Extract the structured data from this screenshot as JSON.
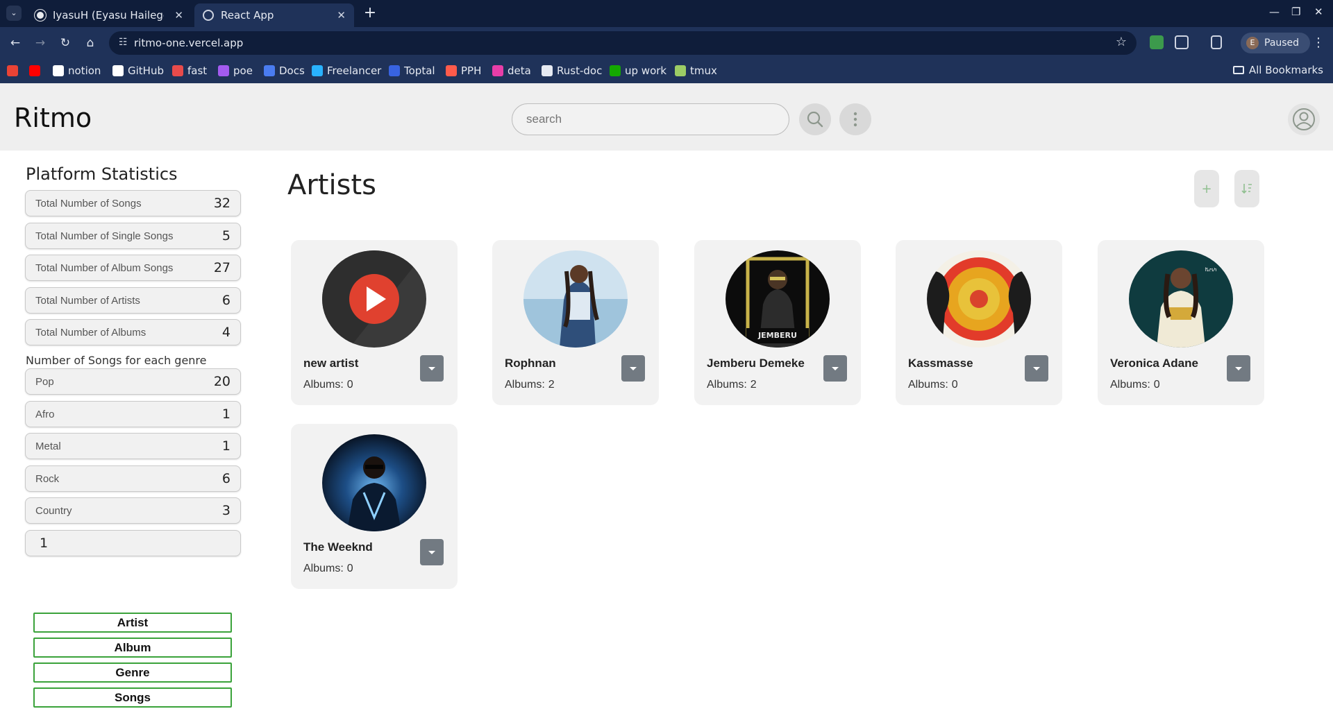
{
  "browser": {
    "tabs": [
      {
        "title": "IyasuH (Eyasu Hailegebr",
        "close": "✕"
      },
      {
        "title": "React App",
        "close": "✕"
      }
    ],
    "new_tab": "+",
    "url": "ritmo-one.vercel.app",
    "profile": {
      "initial": "E",
      "status": "Paused"
    },
    "window_controls": {
      "minimize": "—",
      "maximize": "❐",
      "close": "✕"
    },
    "bookmarks": [
      {
        "label": "",
        "icon": "gmail-icon",
        "color": "#ea4335"
      },
      {
        "label": "",
        "icon": "youtube-icon",
        "color": "#ff0000"
      },
      {
        "label": "notion",
        "icon": "notion-icon",
        "color": "#ffffff"
      },
      {
        "label": "GitHub",
        "icon": "github-icon",
        "color": "#ffffff"
      },
      {
        "label": "fast",
        "icon": "fast-icon",
        "color": "#e84b4b"
      },
      {
        "label": "poe",
        "icon": "poe-icon",
        "color": "#a35bf0"
      },
      {
        "label": "Docs",
        "icon": "docs-icon",
        "color": "#4a7cf0"
      },
      {
        "label": "Freelancer",
        "icon": "freelancer-icon",
        "color": "#29b2fe"
      },
      {
        "label": "Toptal",
        "icon": "toptal-icon",
        "color": "#3863e0"
      },
      {
        "label": "PPH",
        "icon": "pph-icon",
        "color": "#ff5b4b"
      },
      {
        "label": "deta",
        "icon": "deta-icon",
        "color": "#e83ea8"
      },
      {
        "label": "Rust-doc",
        "icon": "rust-icon",
        "color": "#e6eaf2"
      },
      {
        "label": "up work",
        "icon": "upwork-icon",
        "color": "#14a800"
      },
      {
        "label": "tmux",
        "icon": "tmux-icon",
        "color": "#9ccc65"
      }
    ],
    "all_bookmarks": "All Bookmarks"
  },
  "app": {
    "logo": "Ritmo",
    "search_placeholder": "search"
  },
  "sidebar": {
    "title": "Platform Statistics",
    "stats": [
      {
        "label": "Total Number of Songs",
        "value": "32"
      },
      {
        "label": "Total Number of Single Songs",
        "value": "5"
      },
      {
        "label": "Total Number of Album Songs",
        "value": "27"
      },
      {
        "label": "Total Number of Artists",
        "value": "6"
      },
      {
        "label": "Total Number of Albums",
        "value": "4"
      }
    ],
    "genre_heading": "Number of Songs for each genre",
    "genres": [
      {
        "label": "Pop",
        "value": "20"
      },
      {
        "label": "Afro",
        "value": "1"
      },
      {
        "label": "Metal",
        "value": "1"
      },
      {
        "label": "Rock",
        "value": "6"
      },
      {
        "label": "Country",
        "value": "3"
      }
    ],
    "extra_value": "1",
    "nav": [
      "Artist",
      "Album",
      "Genre",
      "Songs"
    ]
  },
  "main": {
    "title": "Artists",
    "add_label": "+",
    "artists": [
      {
        "name": "new artist",
        "albums_label": "Albums:",
        "albums": "0"
      },
      {
        "name": "Rophnan",
        "albums_label": "Albums:",
        "albums": "2"
      },
      {
        "name": "Jemberu Demeke",
        "albums_label": "Albums:",
        "albums": "2"
      },
      {
        "name": "Kassmasse",
        "albums_label": "Albums:",
        "albums": "0"
      },
      {
        "name": "Veronica Adane",
        "albums_label": "Albums:",
        "albums": "0"
      },
      {
        "name": "The Weeknd",
        "albums_label": "Albums:",
        "albums": "0"
      }
    ]
  },
  "colors": {
    "accent_green": "#3aa23a",
    "browser_dark": "#0f1d3a",
    "browser_mid": "#1f3259",
    "menu_button": "#727a82"
  }
}
